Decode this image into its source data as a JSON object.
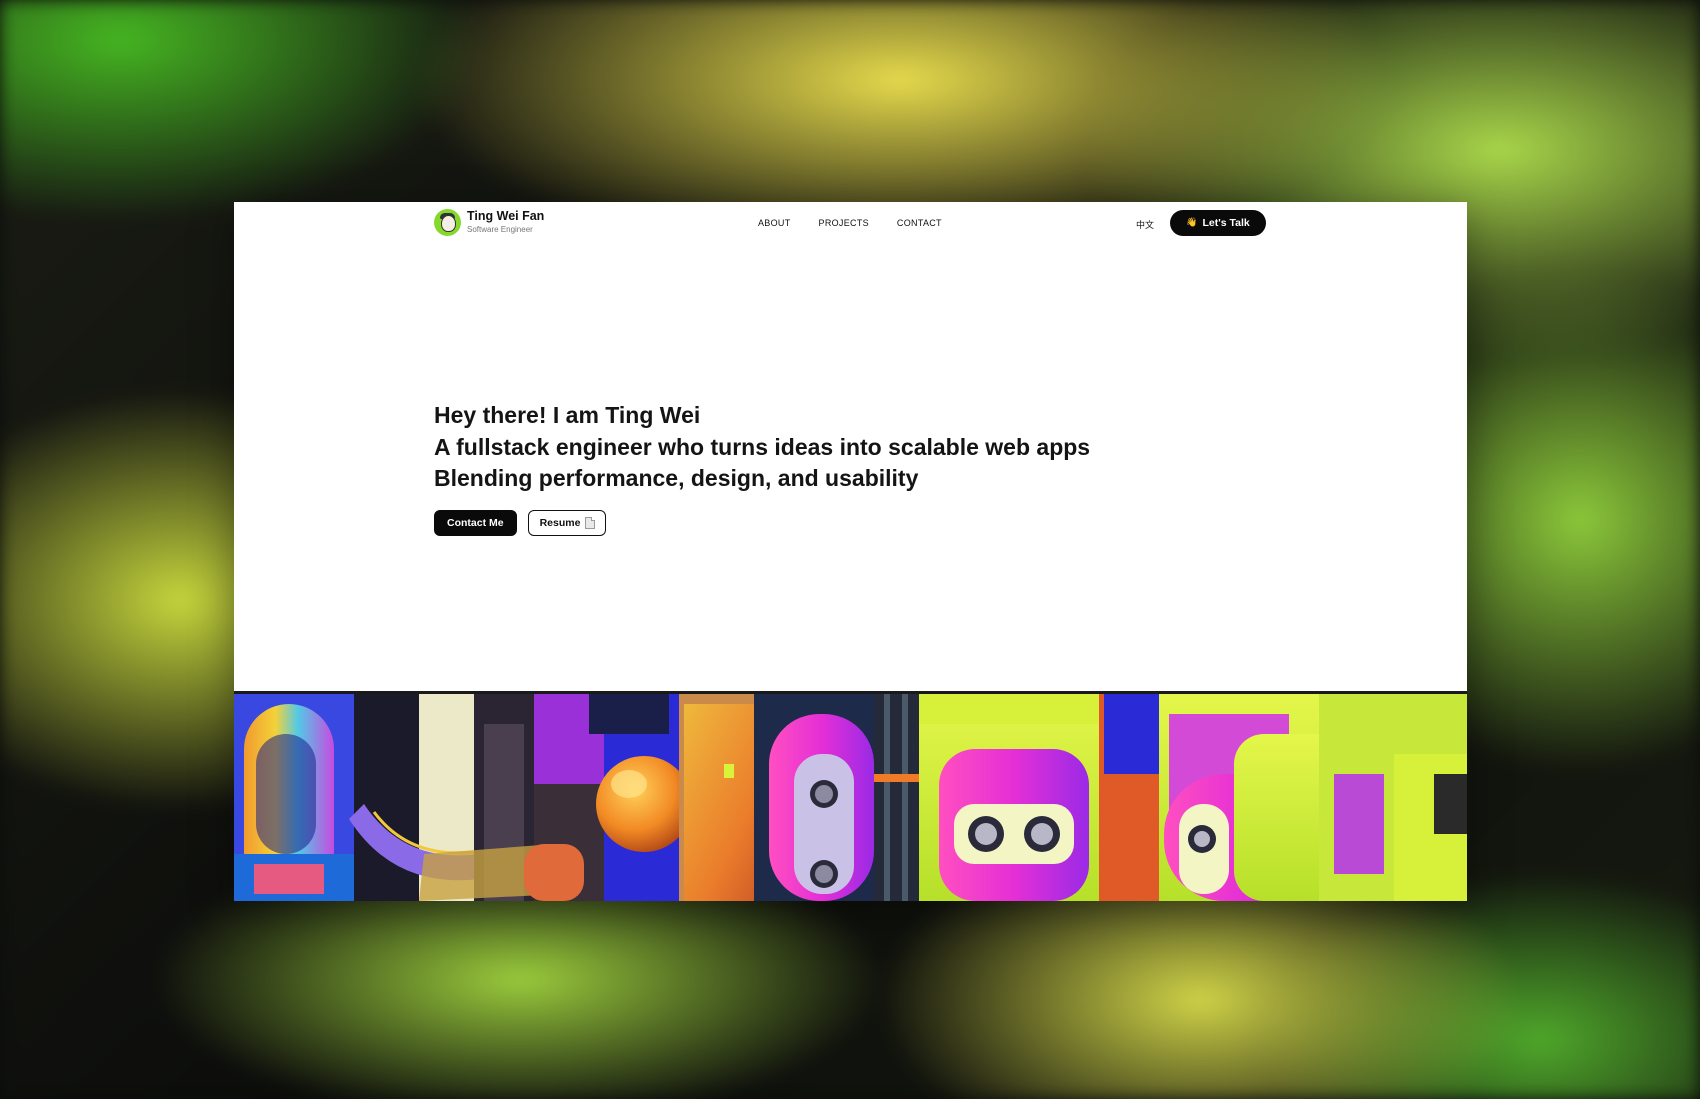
{
  "brand": {
    "name": "Ting Wei Fan",
    "role": "Software Engineer"
  },
  "nav": {
    "items": [
      "ABOUT",
      "PROJECTS",
      "CONTACT"
    ],
    "language": "中文",
    "cta_label": "Let's Talk",
    "cta_icon": "👋"
  },
  "hero": {
    "lines": [
      "Hey there! I am Ting Wei",
      "A fullstack engineer who turns ideas into scalable web apps",
      "Blending performance, design, and usability"
    ],
    "primary_button": "Contact Me",
    "secondary_button": "Resume"
  },
  "colors": {
    "accent": "#0a0a0a",
    "avatar_bg": "#86d82a",
    "art_magenta": "#e52fd6",
    "art_lime": "#c8f23a",
    "art_orange": "#f29a2e",
    "art_blue": "#2a2bd6"
  }
}
